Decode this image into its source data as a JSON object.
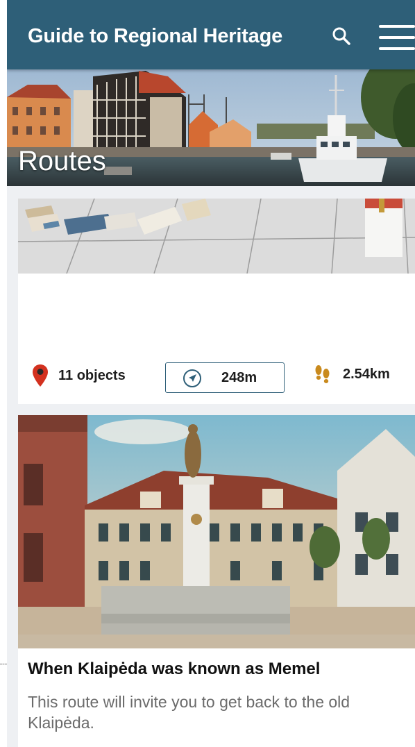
{
  "app": {
    "title": "Guide to Regional Heritage"
  },
  "icons": {
    "search": "search-icon",
    "menu": "hamburger-menu-icon",
    "pin": "map-pin-icon",
    "navigation": "navigation-arrow-icon",
    "footsteps": "footsteps-icon"
  },
  "hero": {
    "title": "Routes"
  },
  "route_card_1": {
    "objects_label": "11 objects",
    "distance_label": "248m",
    "length_label": "2.54km"
  },
  "route_card_2": {
    "title": "When Klaipėda was known as Memel",
    "description": "This route will invite you to get back to the old Klaipėda."
  },
  "colors": {
    "header": "#2e5f78",
    "pin": "#d3311f",
    "footsteps": "#c98a1e",
    "background": "#eef0f3"
  }
}
